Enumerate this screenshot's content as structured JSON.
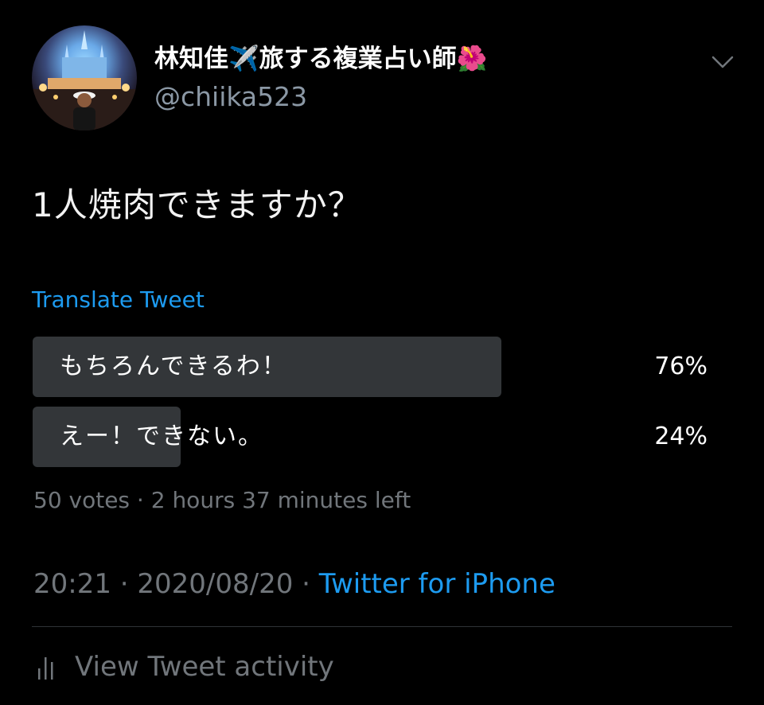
{
  "tweet": {
    "author": {
      "display_name": "林知佳✈️旅する複業占い師🌺",
      "handle": "@chiika523"
    },
    "text": "1人焼肉できますか？",
    "translate_label": "Translate Tweet"
  },
  "poll": {
    "options": [
      {
        "label": "もちろんできるわ！",
        "percent_text": "76%",
        "fraction": 0.76
      },
      {
        "label": "えー！できない。",
        "percent_text": "24%",
        "fraction": 0.24
      }
    ],
    "meta": "50 votes · 2 hours 37 minutes left"
  },
  "timestamp": {
    "time_date": "20:21 · 2020/08/20 · ",
    "source": "Twitter for iPhone"
  },
  "activity_label": "View Tweet activity",
  "colors": {
    "background": "#000000",
    "link": "#1d9bf0",
    "muted": "#71767b",
    "poll_bar": "#333639"
  },
  "icons": {
    "more": "chevron-down-icon",
    "activity": "bar-chart-icon"
  }
}
